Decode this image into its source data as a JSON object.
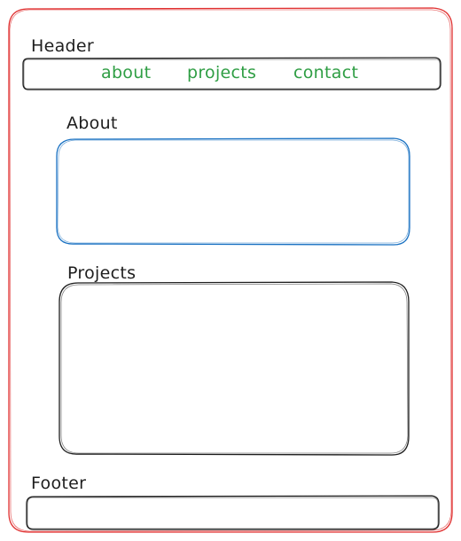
{
  "page": {
    "border_color": "#e03131",
    "stroke_color": "#1e1e1e",
    "about_box_color": "#1971c2",
    "nav_link_color": "#2f9e44"
  },
  "header": {
    "label": "Header",
    "nav": [
      "about",
      "projects",
      "contact"
    ]
  },
  "about": {
    "label": "About"
  },
  "projects": {
    "label": "Projects"
  },
  "footer": {
    "label": "Footer"
  }
}
